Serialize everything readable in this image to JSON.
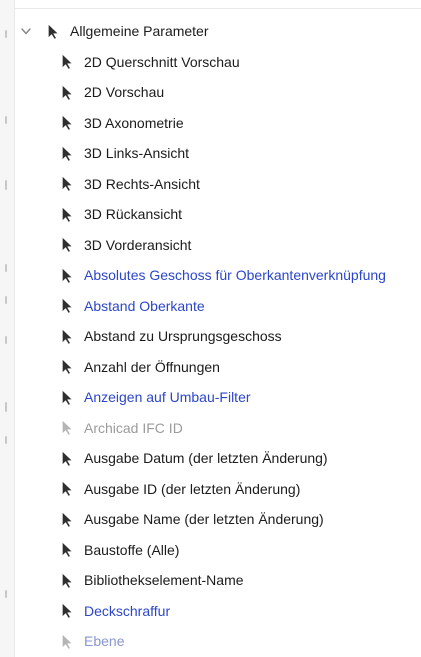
{
  "tree": {
    "group": {
      "label": "Allgemeine Parameter",
      "expanded": true,
      "icon": "cursor-arrow-icon"
    },
    "items": [
      {
        "label": "2D Querschnitt Vorschau",
        "state": "normal"
      },
      {
        "label": "2D Vorschau",
        "state": "normal"
      },
      {
        "label": "3D Axonometrie",
        "state": "normal"
      },
      {
        "label": "3D Links-Ansicht",
        "state": "normal"
      },
      {
        "label": "3D Rechts-Ansicht",
        "state": "normal"
      },
      {
        "label": "3D Rückansicht",
        "state": "normal"
      },
      {
        "label": "3D Vorderansicht",
        "state": "normal"
      },
      {
        "label": "Absolutes Geschoss für Oberkantenverknüpfung",
        "state": "linked"
      },
      {
        "label": "Abstand Oberkante",
        "state": "linked"
      },
      {
        "label": "Abstand zu Ursprungsgeschoss",
        "state": "normal"
      },
      {
        "label": "Anzahl der Öffnungen",
        "state": "normal"
      },
      {
        "label": "Anzeigen auf Umbau-Filter",
        "state": "linked"
      },
      {
        "label": "Archicad IFC ID",
        "state": "disabled"
      },
      {
        "label": "Ausgabe Datum (der letzten Änderung)",
        "state": "normal"
      },
      {
        "label": "Ausgabe ID (der letzten Änderung)",
        "state": "normal"
      },
      {
        "label": "Ausgabe Name (der letzten Änderung)",
        "state": "normal"
      },
      {
        "label": "Baustoffe (Alle)",
        "state": "normal"
      },
      {
        "label": "Bibliothekselement-Name",
        "state": "normal"
      },
      {
        "label": "Deckschraffur",
        "state": "linked"
      },
      {
        "label": "Ebene",
        "state": "linked-disabled"
      }
    ]
  },
  "colors": {
    "normal_text": "#1b1b1b",
    "linked_text": "#2b46c9",
    "disabled_text": "#9b9b9b",
    "linked_disabled_text": "#8a96cf",
    "icon": "#2f2f2f"
  }
}
